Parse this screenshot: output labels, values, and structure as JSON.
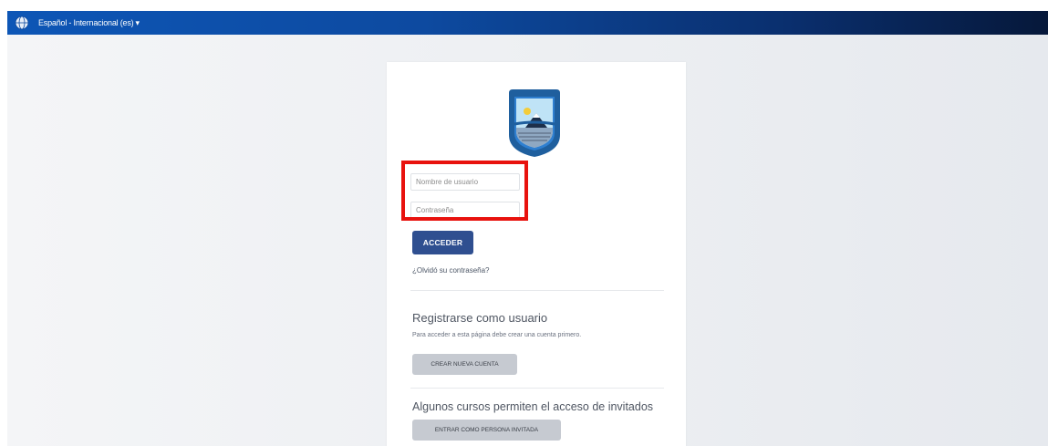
{
  "header": {
    "language_label": "Español - Internacional (es)",
    "caret": "▾"
  },
  "login": {
    "username_placeholder": "Nombre de usuario",
    "password_placeholder": "Contraseña",
    "submit_label": "ACCEDER",
    "forgot_link": "¿Olvidó su contraseña?"
  },
  "signup": {
    "title": "Registrarse como usuario",
    "description": "Para acceder a esta página debe crear una cuenta primero.",
    "button_label": "CREAR NUEVA CUENTA"
  },
  "guest": {
    "title": "Algunos cursos permiten el acceso de invitados",
    "button_label": "ENTRAR COMO PERSONA INVITADA"
  },
  "colors": {
    "topbar": "#0d4aa0",
    "primary_button": "#2f4f90",
    "highlight": "#e8120e"
  },
  "icons": [
    "globe-icon",
    "university-logo"
  ]
}
